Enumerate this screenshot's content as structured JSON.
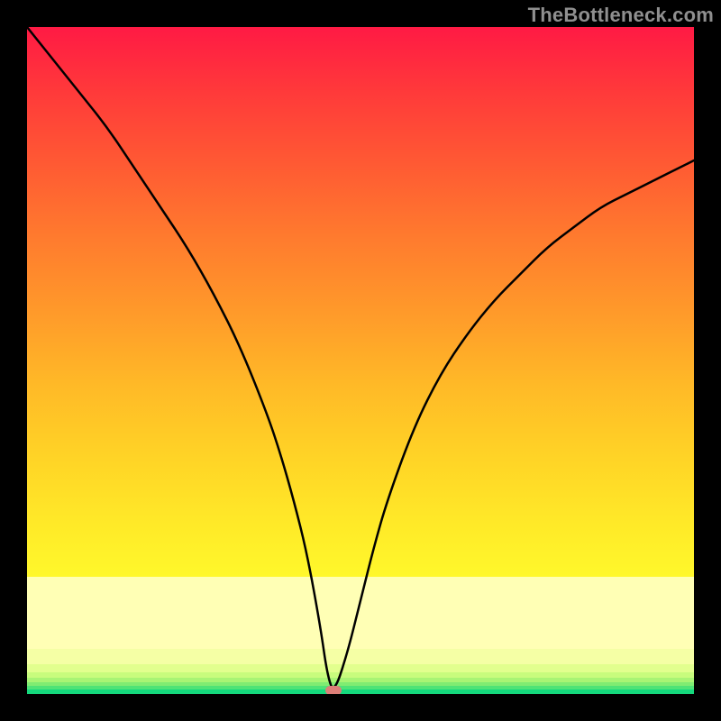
{
  "watermark": "TheBottleneck.com",
  "chart_data": {
    "type": "line",
    "title": "",
    "xlabel": "",
    "ylabel": "",
    "xlim": [
      0,
      100
    ],
    "ylim": [
      0,
      100
    ],
    "grid": false,
    "curve": {
      "name": "bottleneck-curve",
      "color": "#000000",
      "x": [
        0,
        4,
        8,
        12,
        16,
        20,
        24,
        28,
        32,
        36,
        38,
        40,
        42,
        44,
        45,
        46,
        48,
        50,
        52,
        54,
        58,
        62,
        66,
        70,
        74,
        78,
        82,
        86,
        90,
        94,
        98,
        100
      ],
      "y": [
        100,
        95,
        90,
        85,
        79,
        73,
        67,
        60,
        52,
        42,
        36,
        29,
        21,
        10,
        3,
        0,
        6,
        14,
        22,
        29,
        40,
        48,
        54,
        59,
        63,
        67,
        70,
        73,
        75,
        77,
        79,
        80
      ]
    },
    "min_point": {
      "x": 46,
      "y": 0,
      "color": "#de7e78"
    },
    "bands": [
      {
        "color": "#ffffb5",
        "from": 610,
        "to": 690
      },
      {
        "color": "#f5ffa5",
        "from": 690,
        "to": 707
      },
      {
        "color": "#e2ff8e",
        "from": 707,
        "to": 716
      },
      {
        "color": "#c8fc7d",
        "from": 716,
        "to": 722
      },
      {
        "color": "#a8f474",
        "from": 722,
        "to": 727
      },
      {
        "color": "#7fec72",
        "from": 727,
        "to": 731
      },
      {
        "color": "#4ee376",
        "from": 731,
        "to": 735
      },
      {
        "color": "#15d97d",
        "from": 735,
        "to": 740
      }
    ]
  }
}
